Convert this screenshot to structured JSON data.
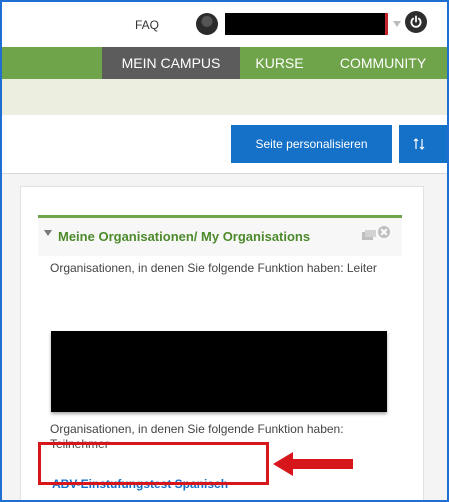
{
  "topbar": {
    "faq": "FAQ",
    "avatar_icon": "user-avatar-icon",
    "power_icon": "power-icon",
    "caret_icon": "chevron-down-icon"
  },
  "nav": {
    "items": [
      {
        "label": "MEIN CAMPUS",
        "active": true
      },
      {
        "label": "KURSE",
        "active": false
      },
      {
        "label": "COMMUNITY",
        "active": false
      }
    ]
  },
  "toolbar": {
    "personalize_label": "Seite personalisieren",
    "sort_icon": "sort-arrows-icon"
  },
  "portlet": {
    "title": "Meine Organisationen/ My Organisations",
    "leader_text": "Organisationen, in denen Sie folgende Funktion haben: Leiter",
    "participant_text": "Organisationen, in denen Sie folgende Funktion haben: Teilnehmer",
    "org_link": "ABV-Einstufungstest Spanisch"
  },
  "colors": {
    "nav_green": "#6fa44a",
    "nav_active": "#5c5c5c",
    "button_blue": "#1570c8",
    "title_green": "#4d8a2b",
    "annotation_red": "#d6161b"
  }
}
